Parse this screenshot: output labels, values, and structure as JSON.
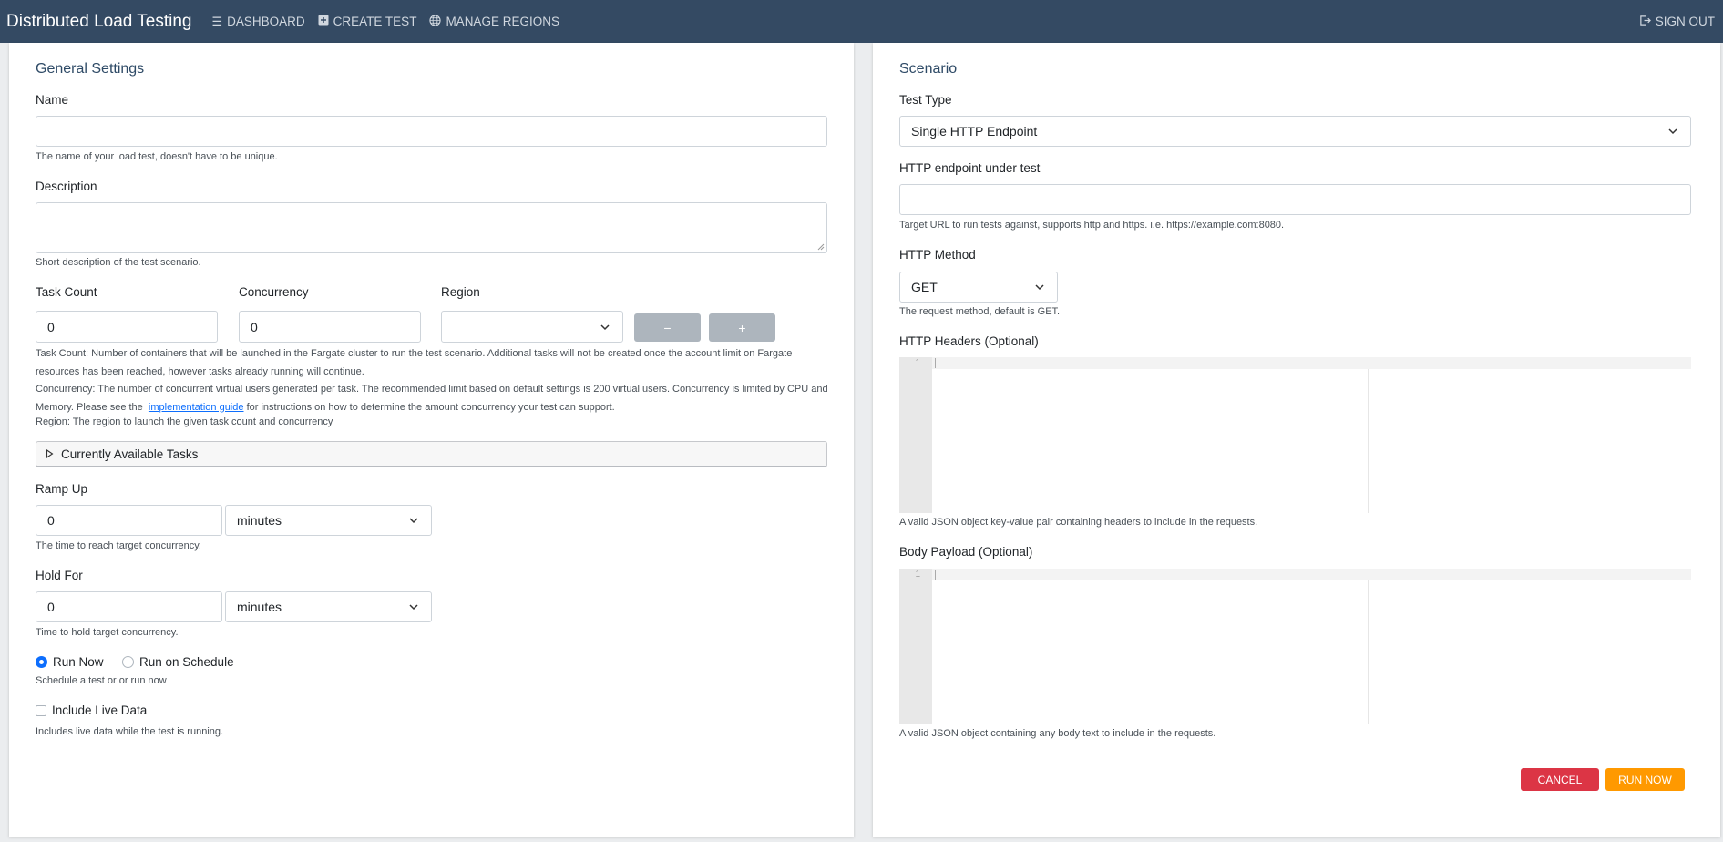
{
  "app": {
    "title": "Distributed Load Testing"
  },
  "nav": {
    "dashboard": "DASHBOARD",
    "create_test": "CREATE TEST",
    "manage_regions": "MANAGE REGIONS",
    "sign_out": "SIGN OUT"
  },
  "general": {
    "title": "General Settings",
    "name_label": "Name",
    "name_value": "",
    "name_help": "The name of your load test, doesn't have to be unique.",
    "description_label": "Description",
    "description_value": "",
    "description_help": "Short description of the test scenario.",
    "task_count_label": "Task Count",
    "task_count_value": "0",
    "concurrency_label": "Concurrency",
    "concurrency_value": "0",
    "region_label": "Region",
    "region_value": "",
    "minus_label": "−",
    "plus_label": "+",
    "help_task_count": "Task Count: Number of containers that will be launched in the Fargate cluster to run the test scenario. Additional tasks will not be created once the account limit on Fargate resources has been reached, however tasks already running will continue.",
    "help_concurrency_a": "Concurrency: The number of concurrent virtual users generated per task. The recommended limit based on default settings is 200 virtual users. Concurrency is limited by CPU and Memory. Please see the",
    "help_concurrency_link": "implementation guide",
    "help_concurrency_b": "for instructions on how to determine the amount concurrency your test can support.",
    "help_region": "Region: The region to launch the given task count and concurrency",
    "available_tasks": "Currently Available Tasks",
    "ramp_up_label": "Ramp Up",
    "ramp_up_value": "0",
    "ramp_up_unit": "minutes",
    "ramp_up_help": "The time to reach target concurrency.",
    "hold_for_label": "Hold For",
    "hold_for_value": "0",
    "hold_for_unit": "minutes",
    "hold_for_help": "Time to hold target concurrency.",
    "run_now_label": "Run Now",
    "run_schedule_label": "Run on Schedule",
    "run_help": "Schedule a test or or run now",
    "live_data_label": "Include Live Data",
    "live_data_help": "Includes live data while the test is running."
  },
  "scenario": {
    "title": "Scenario",
    "test_type_label": "Test Type",
    "test_type_value": "Single HTTP Endpoint",
    "endpoint_label": "HTTP endpoint under test",
    "endpoint_value": "",
    "endpoint_help": "Target URL to run tests against, supports http and https. i.e. https://example.com:8080.",
    "method_label": "HTTP Method",
    "method_value": "GET",
    "method_help": "The request method, default is GET.",
    "headers_label": "HTTP Headers (Optional)",
    "headers_line": "1",
    "headers_help": "A valid JSON object key-value pair containing headers to include in the requests.",
    "body_label": "Body Payload (Optional)",
    "body_line": "1",
    "body_help": "A valid JSON object containing any body text to include in the requests."
  },
  "actions": {
    "cancel": "CANCEL",
    "run_now": "RUN NOW"
  },
  "colors": {
    "navbar": "#344a63",
    "cancel": "#dc3545",
    "run": "#ff9900",
    "accent": "#0d6efd"
  }
}
